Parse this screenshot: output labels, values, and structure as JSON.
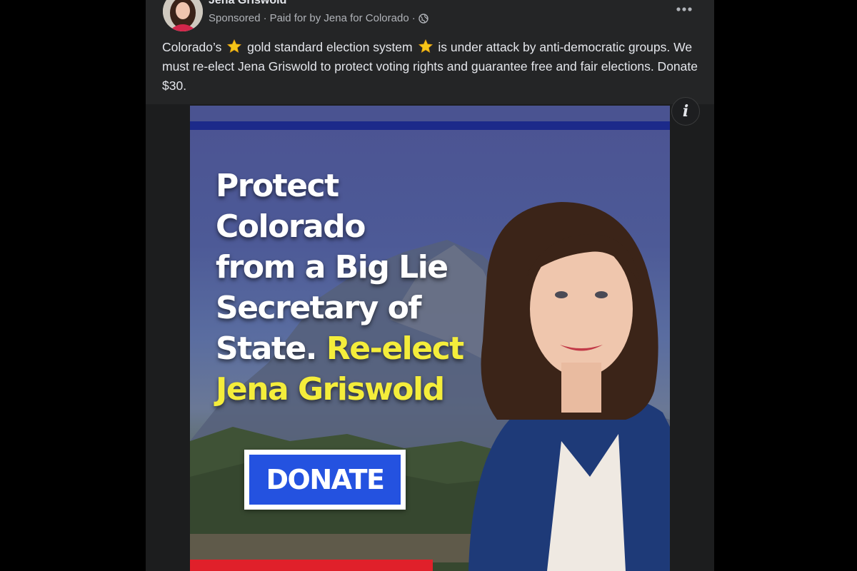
{
  "post": {
    "author_name": "Jena Griswold",
    "meta": {
      "sponsored": "Sponsored",
      "separator": " · ",
      "paid_for": "Paid for by Jena for Colorado",
      "trailing_separator": " · ",
      "audience_icon": "globe-icon"
    },
    "more_icon": "more-options-icon",
    "text": {
      "part1": "Colorado’s",
      "part2": "gold standard election system",
      "part3": "is under attack by anti-democratic groups. We must re-elect Jena Griswold to protect voting rights and guarantee free and fair elections. Donate $30.",
      "emoji": "star-icon"
    }
  },
  "ad": {
    "info_label": "i",
    "headline_line1": "Protect",
    "headline_line2": "Colorado",
    "headline_line3": "from a Big Lie",
    "headline_line4": "Secretary of",
    "headline_line5_white": "State.",
    "headline_line5_yellow": "Re-elect",
    "headline_line6_yellow": "Jena Griswold",
    "donate_label": "DONATE",
    "colors": {
      "headline_white": "#ffffff",
      "headline_yellow": "#f4ed3b",
      "donate_blue": "#2452e0",
      "top_stripe": "#1c2a8a",
      "bottom_stripe": "#e0202a"
    }
  }
}
